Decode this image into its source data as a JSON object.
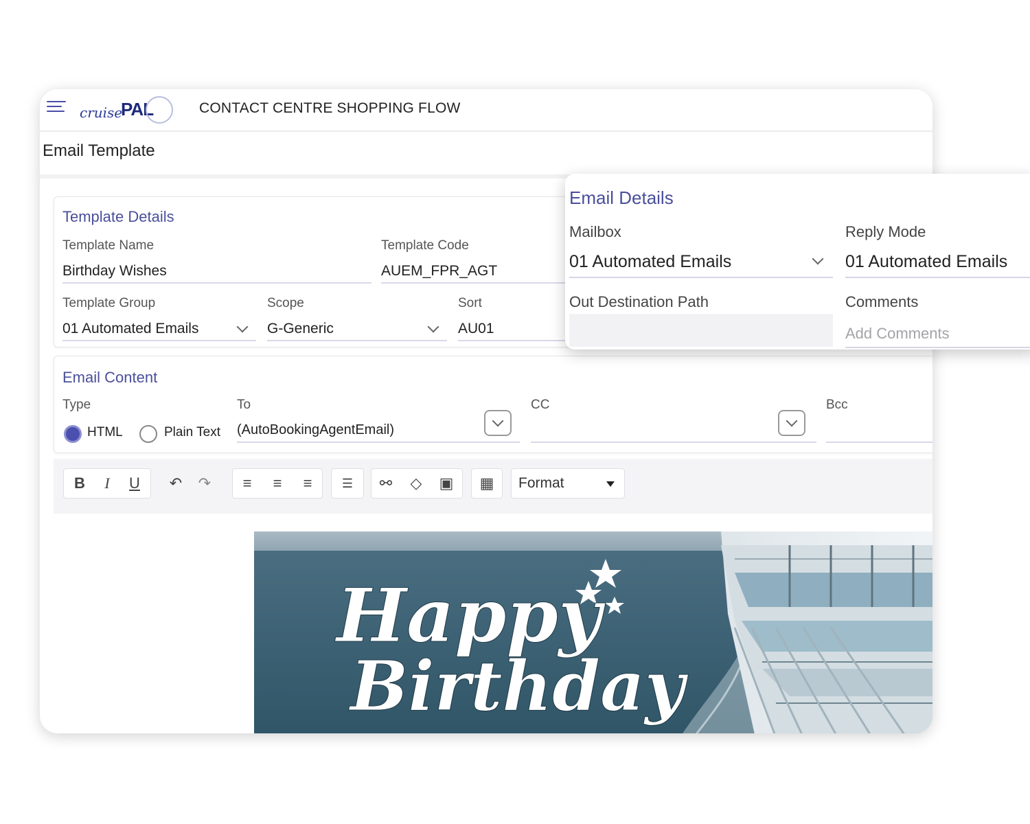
{
  "app": {
    "logo_word": "cruise",
    "logo_mark": "PAL",
    "title": "CONTACT CENTRE SHOPPING FLOW"
  },
  "page": {
    "title": "Email Template"
  },
  "template_details": {
    "heading": "Template Details",
    "template_name": {
      "label": "Template Name",
      "value": "Birthday Wishes"
    },
    "template_code": {
      "label": "Template Code",
      "value": "AUEM_FPR_AGT"
    },
    "template_group": {
      "label": "Template Group",
      "value": "01 Automated Emails"
    },
    "scope": {
      "label": "Scope",
      "value": "G-Generic"
    },
    "sort": {
      "label": "Sort",
      "value": "AU01"
    }
  },
  "email_content": {
    "heading": "Email Content",
    "type_label": "Type",
    "type_options": [
      "HTML",
      "Plain Text"
    ],
    "type_selected": "HTML",
    "to": {
      "label": "To",
      "value": "(AutoBookingAgentEmail)"
    },
    "cc": {
      "label": "CC",
      "value": ""
    },
    "bcc": {
      "label": "Bcc",
      "value": ""
    }
  },
  "toolbar": {
    "bold": "B",
    "italic": "I",
    "underline": "U",
    "format_label": "Format"
  },
  "banner": {
    "line1": "Happy",
    "line2": "Birthday"
  },
  "email_details": {
    "heading": "Email Details",
    "mailbox": {
      "label": "Mailbox",
      "value": "01 Automated Emails"
    },
    "reply_mode": {
      "label": "Reply Mode",
      "value": "01 Automated Emails"
    },
    "out_destination_path": {
      "label": "Out Destination Path",
      "value": ""
    },
    "comments": {
      "label": "Comments",
      "placeholder": "Add Comments"
    }
  },
  "colors": {
    "accent": "#4a4f9a",
    "radio_selected": "#4b4fae",
    "sea": "#3d6478"
  }
}
